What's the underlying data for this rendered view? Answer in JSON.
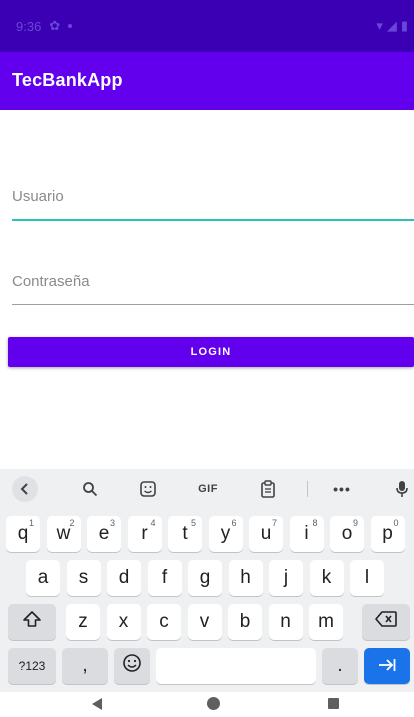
{
  "status_bar": {
    "time": "9:36"
  },
  "app_bar": {
    "title": "TecBankApp"
  },
  "form": {
    "username_placeholder": "Usuario",
    "password_placeholder": "Contraseña",
    "login_label": "LOGIN"
  },
  "colors": {
    "primary": "#6200ee",
    "primary_dark": "#3700b3",
    "focus_underline": "#2ac4b7",
    "enter_key": "#1a73e8"
  },
  "keyboard": {
    "toolbar": {
      "back": "<",
      "gif": "GIF",
      "more": "•••"
    },
    "row1": [
      {
        "key": "q",
        "hint": "1"
      },
      {
        "key": "w",
        "hint": "2"
      },
      {
        "key": "e",
        "hint": "3"
      },
      {
        "key": "r",
        "hint": "4"
      },
      {
        "key": "t",
        "hint": "5"
      },
      {
        "key": "y",
        "hint": "6"
      },
      {
        "key": "u",
        "hint": "7"
      },
      {
        "key": "i",
        "hint": "8"
      },
      {
        "key": "o",
        "hint": "9"
      },
      {
        "key": "p",
        "hint": "0"
      }
    ],
    "row2": [
      "a",
      "s",
      "d",
      "f",
      "g",
      "h",
      "j",
      "k",
      "l"
    ],
    "row3": [
      "z",
      "x",
      "c",
      "v",
      "b",
      "n",
      "m"
    ],
    "row4": {
      "symbols": "?123",
      "comma": ",",
      "period": "."
    }
  },
  "icons": {
    "toolbar": [
      "back-icon",
      "search-icon",
      "sticker-icon",
      "gif-icon",
      "clipboard-icon",
      "more-icon",
      "mic-icon"
    ],
    "keys": [
      "shift-icon",
      "backspace-icon",
      "emoji-icon",
      "enter-arrow-icon"
    ],
    "nav": [
      "nav-back-icon",
      "nav-home-icon",
      "nav-recents-icon"
    ]
  }
}
